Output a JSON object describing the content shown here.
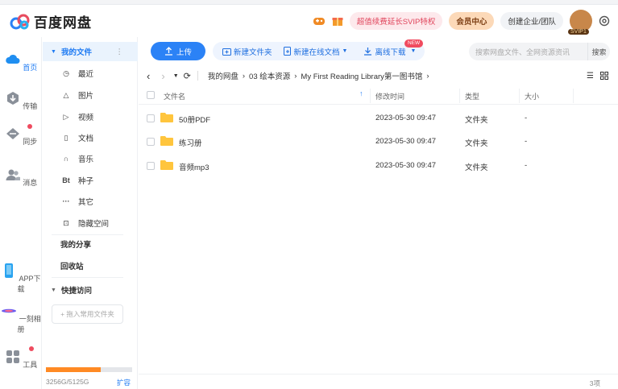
{
  "app": {
    "title": "百度网盘"
  },
  "header": {
    "promo_label": "超值续费延长SVIP特权",
    "vip_center_label": "会员中心",
    "enterprise_label": "创建企业/团队",
    "vip_badge": "SVIP1"
  },
  "rail": {
    "items": [
      {
        "label": "首页"
      },
      {
        "label": "传输"
      },
      {
        "label": "同步"
      },
      {
        "label": "消息"
      },
      {
        "label": "APP下载"
      },
      {
        "label": "一刻相册"
      },
      {
        "label": "工具"
      }
    ]
  },
  "sidebar": {
    "my_files": "我的文件",
    "items": [
      {
        "label": "最近",
        "icon": "clock-icon"
      },
      {
        "label": "图片",
        "icon": "image-icon"
      },
      {
        "label": "视频",
        "icon": "play-icon"
      },
      {
        "label": "文档",
        "icon": "document-icon"
      },
      {
        "label": "音乐",
        "icon": "headphones-icon"
      },
      {
        "label": "种子",
        "icon": "bt-icon",
        "glyph": "Bt"
      },
      {
        "label": "其它",
        "icon": "more-icon",
        "glyph": "···"
      },
      {
        "label": "隐藏空间",
        "icon": "lock-icon"
      }
    ],
    "my_share": "我的分享",
    "recycle": "回收站",
    "quick_access": "快捷访问",
    "quick_drag": "+ 拖入常用文件夹",
    "quota_text": "3256G/5125G",
    "quota_fraction": 0.635,
    "expand": "扩容"
  },
  "toolbar": {
    "upload": "上传",
    "new_folder": "新建文件夹",
    "new_online_doc": "新建在线文档",
    "new_tag": "NEW",
    "offline_download": "离线下载",
    "search_placeholder": "搜索网盘文件、全网资源资讯",
    "search_button": "搜索"
  },
  "breadcrumb": {
    "items": [
      "我的网盘",
      "03 绘本资源",
      "My First Reading Library第一图书馆"
    ]
  },
  "table": {
    "headers": {
      "name": "文件名",
      "modified": "修改时间",
      "type": "类型",
      "size": "大小"
    },
    "rows": [
      {
        "name": "50册PDF",
        "modified": "2023-05-30 09:47",
        "type": "文件夹",
        "size": "-"
      },
      {
        "name": "练习册",
        "modified": "2023-05-30 09:47",
        "type": "文件夹",
        "size": "-"
      },
      {
        "name": "音频mp3",
        "modified": "2023-05-30 09:47",
        "type": "文件夹",
        "size": "-"
      }
    ],
    "count": "3项"
  },
  "colors": {
    "accent": "#2b82f6",
    "promo": "#e0455c",
    "vip": "#fcd9b8",
    "folder": "#ffc53d",
    "quota": "#ff8a24"
  }
}
